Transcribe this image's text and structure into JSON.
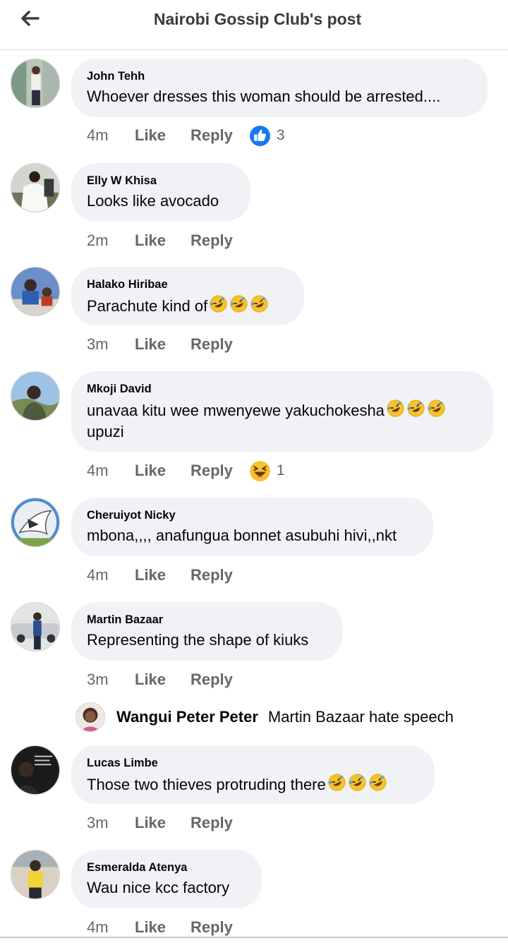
{
  "header": {
    "title": "Nairobi Gossip Club's post",
    "back_icon": "arrow-left-icon"
  },
  "actions": {
    "like_label": "Like",
    "reply_label": "Reply"
  },
  "comments": [
    {
      "author": "John Tehh",
      "text": "Whoever dresses this woman should be arrested....",
      "time": "4m",
      "reaction_icon": "like-reaction-icon",
      "reaction_count": "3"
    },
    {
      "author": "Elly W Khisa",
      "text": "Looks like avocado",
      "time": "2m"
    },
    {
      "author": "Halako Hiribae",
      "text": "Parachute kind of",
      "emoji_count": 3,
      "time": "3m"
    },
    {
      "author": "Mkoji David",
      "text_line1": "unavaa kitu wee mwenyewe yakuchokesha",
      "text_line2": "upuzi",
      "emoji_count": 3,
      "time": "4m",
      "reaction_icon": "haha-reaction-icon",
      "reaction_count": "1"
    },
    {
      "author": "Cheruiyot Nicky",
      "text": "mbona,,,, anafungua bonnet asubuhi hivi,,nkt",
      "time": "4m"
    },
    {
      "author": "Martin Bazaar",
      "text": "Representing the shape of kiuks",
      "time": "3m"
    },
    {
      "author": "Lucas Limbe",
      "text": "Those two thieves protruding there",
      "emoji_count": 3,
      "time": "3m"
    },
    {
      "author": "Esmeralda Atenya",
      "text": "Wau nice kcc factory",
      "time": "4m"
    }
  ],
  "reply_preview": {
    "author": "Wangui Peter Peter",
    "text": "Martin Bazaar hate speech"
  },
  "colors": {
    "bubble": "#f0f2f5",
    "secondary_text": "#65676b",
    "like_blue": "#1877f2",
    "emoji_yellow": "#f7c22c"
  }
}
